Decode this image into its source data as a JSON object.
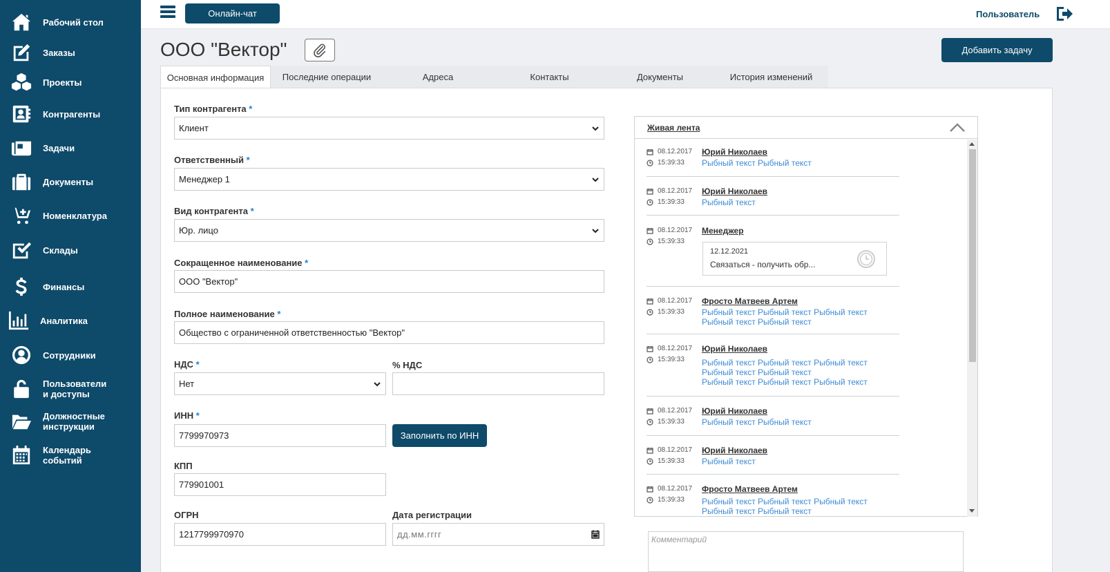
{
  "sidebar": {
    "items": [
      {
        "label": "Рабочий стол",
        "icon": "home-icon"
      },
      {
        "label": "Заказы",
        "icon": "edit-icon"
      },
      {
        "label": "Проекты",
        "icon": "cubes-icon"
      },
      {
        "label": "Контрагенты",
        "icon": "contact-card-icon"
      },
      {
        "label": "Задачи",
        "icon": "newspaper-icon"
      },
      {
        "label": "Документы",
        "icon": "briefcase-icon"
      },
      {
        "label": "Номенклатура",
        "icon": "cart-plus-icon"
      },
      {
        "label": "Склады",
        "icon": "check-square-icon"
      },
      {
        "label": "Финансы",
        "icon": "dollar-icon"
      },
      {
        "label": "Аналитика",
        "icon": "bar-chart-icon"
      },
      {
        "label": "Сотрудники",
        "icon": "user-circle-icon"
      },
      {
        "label": "Пользователи",
        "label2": "и доступы",
        "icon": "unlock-icon"
      },
      {
        "label": "Должностные",
        "label2": "инструкции",
        "icon": "folder-open-icon"
      },
      {
        "label": "Календарь",
        "label2": "событий",
        "icon": "calendar-icon"
      }
    ]
  },
  "topbar": {
    "chat_label": "Онлайн-чат",
    "user_label": "Пользователь"
  },
  "header": {
    "title": "ООО \"Вектор\"",
    "add_task_label": "Добавить задачу"
  },
  "tabs": [
    {
      "label": "Основная информация",
      "active": true
    },
    {
      "label": "Последние операции"
    },
    {
      "label": "Адреса"
    },
    {
      "label": "Контакты"
    },
    {
      "label": "Документы"
    },
    {
      "label": "История изменений"
    }
  ],
  "form": {
    "type": {
      "label": "Тип контрагента",
      "value": "Клиент"
    },
    "responsible": {
      "label": "Ответственный",
      "value": "Менеджер 1"
    },
    "kind": {
      "label": "Вид контрагента",
      "value": "Юр. лицо"
    },
    "short_name": {
      "label": "Сокращенное наименование",
      "value": "ООО \"Вектор\""
    },
    "full_name": {
      "label": "Полное наименование",
      "value": "Общество с ограниченной ответственностью \"Вектор\""
    },
    "vat": {
      "label": "НДС",
      "value": "Нет"
    },
    "vat_percent": {
      "label": "% НДС",
      "value": ""
    },
    "inn": {
      "label": "ИНН",
      "value": "7799970973",
      "fill_button": "Заполнить по ИНН"
    },
    "kpp": {
      "label": "КПП",
      "value": "779901001"
    },
    "ogrn": {
      "label": "ОГРН",
      "value": "1217799970970"
    },
    "reg_date": {
      "label": "Дата регистрации",
      "placeholder": "дд.мм.гггг"
    },
    "required_mark": "*"
  },
  "feed": {
    "title": "Живая лента",
    "entries": [
      {
        "date": "08.12.2017",
        "time": "15:39:33",
        "author": "Юрий Николаев",
        "lines": [
          "Рыбный текст Рыбный текст"
        ]
      },
      {
        "date": "08.12.2017",
        "time": "15:39:33",
        "author": "Юрий Николаев",
        "lines": [
          "Рыбный текст"
        ]
      },
      {
        "date": "08.12.2017",
        "time": "15:39:33",
        "author": "Менеджер",
        "task": {
          "date": "12.12.2021",
          "text": "Связаться - получить обр..."
        }
      },
      {
        "date": "08.12.2017",
        "time": "15:39:33",
        "author": "Фросто Матвеев Артем",
        "lines": [
          "Рыбный текст Рыбный текст Рыбный текст",
          "Рыбный текст Рыбный текст"
        ]
      },
      {
        "date": "08.12.2017",
        "time": "15:39:33",
        "author": "Юрий Николаев",
        "lines": [
          "Рыбный текст Рыбный текст Рыбный текст",
          "Рыбный текст Рыбный текст",
          "Рыбный текст Рыбный текст Рыбный текст"
        ]
      },
      {
        "date": "08.12.2017",
        "time": "15:39:33",
        "author": "Юрий Николаев",
        "lines": [
          "Рыбный текст Рыбный текст"
        ]
      },
      {
        "date": "08.12.2017",
        "time": "15:39:33",
        "author": "Юрий Николаев",
        "lines": [
          "Рыбный текст"
        ]
      },
      {
        "date": "08.12.2017",
        "time": "15:39:33",
        "author": "Фросто Матвеев Артем",
        "lines": [
          "Рыбный текст Рыбный текст Рыбный текст",
          "Рыбный текст Рыбный текст"
        ]
      }
    ],
    "comment_placeholder": "Комментарий"
  },
  "colors": {
    "primary": "#0e4a6a",
    "link": "#3c8ad6",
    "required": "#2b7fc1"
  }
}
